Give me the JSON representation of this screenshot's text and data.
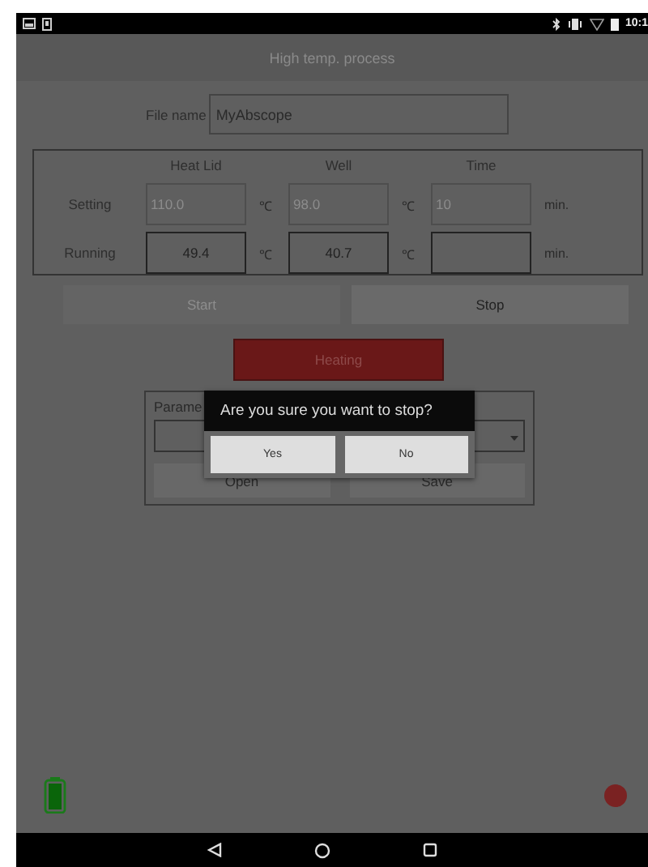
{
  "status_bar": {
    "time": "10:1"
  },
  "title": "High temp. process",
  "file_name": {
    "label": "File name",
    "value": "MyAbscope"
  },
  "table": {
    "columns": [
      "Heat Lid",
      "Well",
      "Time"
    ],
    "rows": [
      {
        "label": "Setting",
        "disabled": true,
        "cells": [
          {
            "value": "110.0",
            "unit": "℃"
          },
          {
            "value": "98.0",
            "unit": "℃"
          },
          {
            "value": "10",
            "unit": "min."
          }
        ]
      },
      {
        "label": "Running",
        "disabled": false,
        "cells": [
          {
            "value": "49.4",
            "unit": "℃"
          },
          {
            "value": "40.7",
            "unit": "℃"
          },
          {
            "unit": "min."
          }
        ]
      }
    ]
  },
  "actions": [
    {
      "label": "Start",
      "disabled": true
    },
    {
      "label": "Stop",
      "disabled": false
    }
  ],
  "status_button": {
    "label": "Heating"
  },
  "parameters": {
    "label": "Parame",
    "buttons": [
      {
        "label": "Open"
      },
      {
        "label": "Save"
      }
    ]
  },
  "dialog": {
    "message": "Are you sure you want to stop?",
    "buttons": [
      {
        "label": "Yes"
      },
      {
        "label": "No"
      }
    ]
  }
}
